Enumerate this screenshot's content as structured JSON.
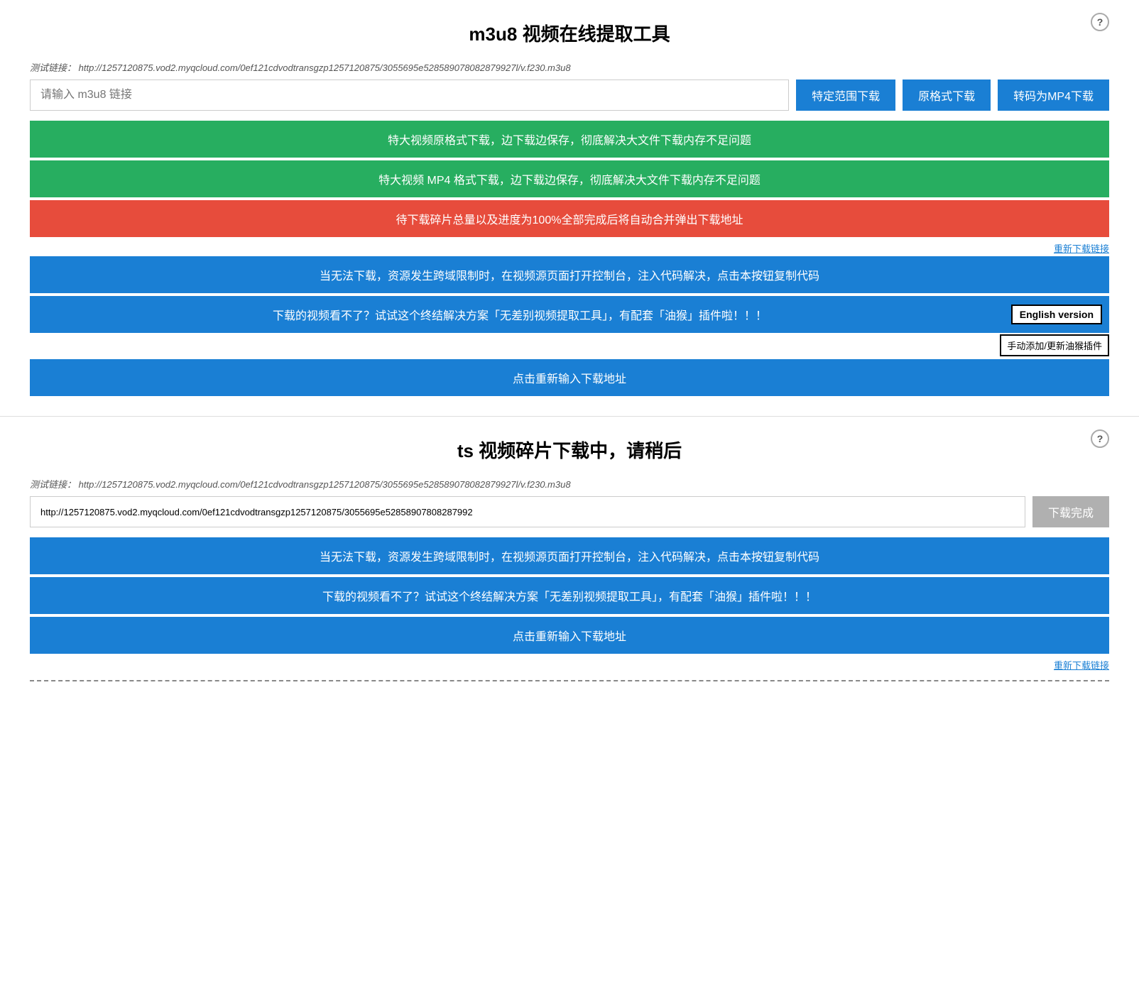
{
  "section1": {
    "title": "m3u8 视频在线提取工具",
    "help_label": "?",
    "test_link_label": "测试链接：",
    "test_link_url": "http://1257120875.vod2.myqcloud.com/0ef121cdvodtransgzp1257120875/3055695e528589078082879927l/v.f230.m3u8",
    "input_placeholder": "请输入 m3u8 链接",
    "btn1_label": "特定范围下载",
    "btn2_label": "原格式下载",
    "btn3_label": "转码为MP4下载",
    "banner_green1": "特大视频原格式下载，边下载边保存，彻底解决大文件下载内存不足问题",
    "banner_green2": "特大视频 MP4 格式下载，边下载边保存，彻底解决大文件下载内存不足问题",
    "banner_red1": "待下载碎片总量以及进度为100%全部完成后将自动合并弹出下载地址",
    "redownload_label": "重新下载链接",
    "banner_blue1": "当无法下载，资源发生跨域限制时，在视频源页面打开控制台，注入代码解决，点击本按钮复制代码",
    "banner_blue2_text": "下载的视频看不了？试试这个终结解决方案「无差别视频提取工具」，有配套「油猴」插件啦！！！",
    "banner_blue2_english": "English version",
    "banner_blue2_manual": "手动添加/更新油猴插件",
    "banner_blue3": "点击重新输入下载地址"
  },
  "section2": {
    "title": "ts 视频碎片下载中，请稍后",
    "help_label": "?",
    "test_link_label": "测试链接：",
    "test_link_url": "http://1257120875.vod2.myqcloud.com/0ef121cdvodtransgzp1257120875/3055695e528589078082879927l/v.f230.m3u8",
    "input_value": "http://1257120875.vod2.myqcloud.com/0ef121cdvodtransgzp1257120875/3055695e52858907808287992",
    "download_done_label": "下载完成",
    "banner_blue1": "当无法下载，资源发生跨域限制时，在视频源页面打开控制台，注入代码解决，点击本按钮复制代码",
    "banner_blue2": "下载的视频看不了？试试这个终结解决方案「无差别视频提取工具」，有配套「油猴」插件啦！！！",
    "banner_blue3": "点击重新输入下载地址",
    "redownload_label": "重新下载链接"
  }
}
